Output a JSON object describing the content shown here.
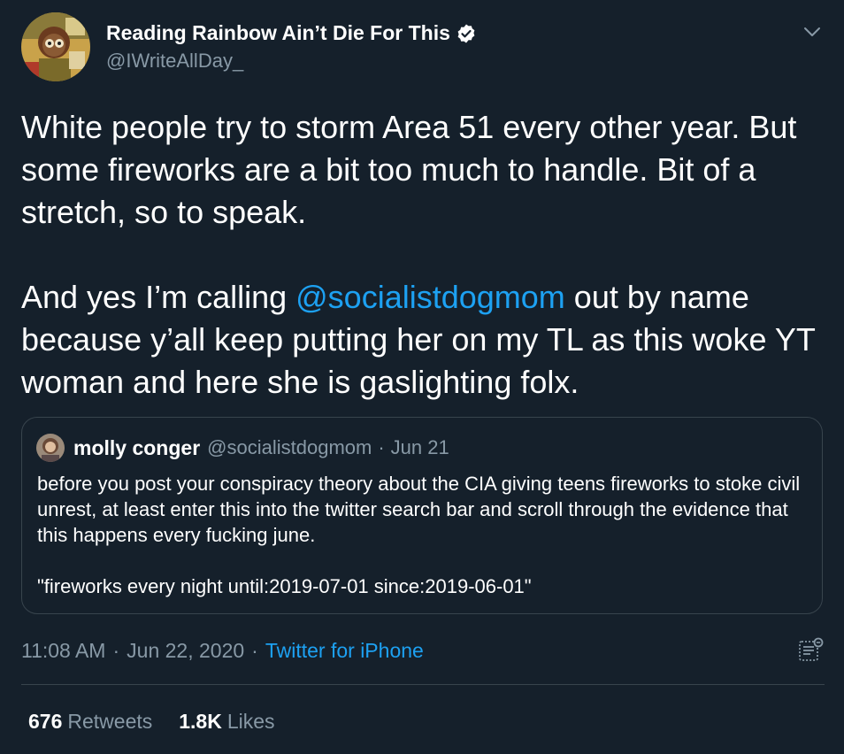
{
  "author": {
    "display_name": "Reading Rainbow Ain’t Die For This",
    "handle": "@IWriteAllDay_",
    "verified": true,
    "avatar_icon": "cartoon-avatar-icon"
  },
  "tweet": {
    "paragraph_1": "White people try to storm Area 51 every other year. But some fireworks are a bit too much to handle. Bit of a stretch, so to speak.",
    "paragraph_2_before": "And yes I’m calling ",
    "paragraph_2_mention": "@socialistdogmom",
    "paragraph_2_after": " out by name because y’all keep putting her on my TL as this woke YT woman and here she is gaslighting folx."
  },
  "quoted_tweet": {
    "display_name": "molly conger",
    "handle": "@socialistdogmom",
    "separator": "·",
    "date": "Jun 21",
    "paragraph_1": "before you post your conspiracy theory about the CIA giving teens fireworks to stoke civil unrest, at least enter this into the twitter search bar and scroll through the evidence that this happens every fucking june.",
    "paragraph_2": "\"fireworks every night until:2019-07-01 since:2019-06-01\""
  },
  "meta": {
    "time": "11:08 AM",
    "separator": "·",
    "date": "Jun 22, 2020",
    "source": "Twitter for iPhone"
  },
  "stats": {
    "retweets_count": "676",
    "retweets_label": "Retweets",
    "likes_count": "1.8K",
    "likes_label": "Likes"
  },
  "colors": {
    "background": "#15202b",
    "link": "#1da1f2",
    "secondary_text": "#8899a6",
    "border": "#38444d"
  }
}
